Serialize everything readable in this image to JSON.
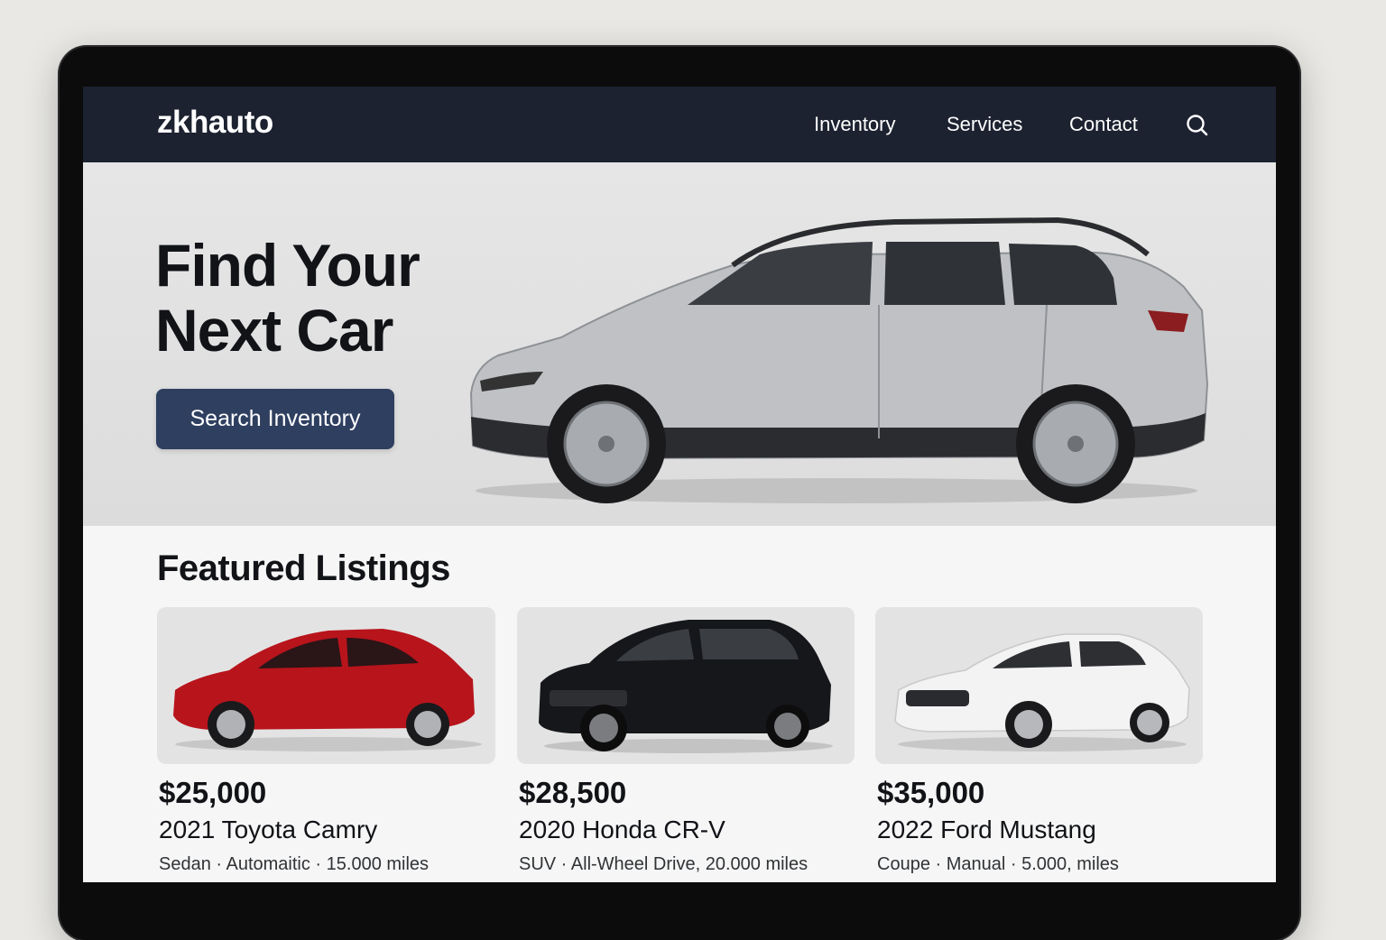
{
  "brand": {
    "logo": "zkhauto"
  },
  "nav": {
    "items": [
      {
        "label": "Inventory"
      },
      {
        "label": "Services"
      },
      {
        "label": "Contact"
      }
    ],
    "search_icon": "search-icon"
  },
  "hero": {
    "title_line1": "Find Your",
    "title_line2": "Next Car",
    "button_label": "Search Inventory",
    "car_color": "#b9bbbe"
  },
  "featured": {
    "title": "Featured Listings",
    "listings": [
      {
        "price": "$25,000",
        "name": "2021 Toyota Camry",
        "specs": "Sedan · Automaitic · 15.000 miles",
        "color": "#b8141c"
      },
      {
        "price": "$28,500",
        "name": "2020 Honda CR-V",
        "specs": "SUV · All-Wheel Drive, 20.000 miles",
        "color": "#16171a"
      },
      {
        "price": "$35,000",
        "name": "2022 Ford Mustang",
        "specs": "Coupe · Manual · 5.000, miles",
        "color": "#f3f3f3"
      }
    ]
  },
  "colors": {
    "nav_bg": "#1c2230",
    "button_bg": "#2f3f60"
  }
}
